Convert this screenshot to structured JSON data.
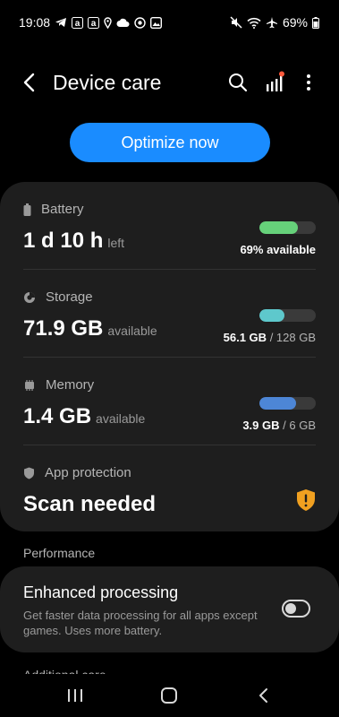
{
  "status_bar": {
    "time": "19:08",
    "battery_percent": "69%",
    "left_icons": [
      "telegram-icon",
      "amazon-icon",
      "amazon-icon",
      "location-icon",
      "cloud-icon",
      "instagram-icon",
      "gallery-icon"
    ],
    "right_icons": [
      "mute-icon",
      "wifi-icon",
      "airplane-icon",
      "battery-icon"
    ]
  },
  "header": {
    "title": "Device care",
    "icons": [
      "back-icon",
      "search-icon",
      "signal-stats-icon",
      "more-vert-icon"
    ]
  },
  "optimize_button": {
    "label": "Optimize now",
    "color": "#1a8cff"
  },
  "battery": {
    "label": "Battery",
    "value_main": "1 d 10 h",
    "value_suffix": "left",
    "detail": "69% available",
    "level": 0.69,
    "bar_color": "#66d17a"
  },
  "storage": {
    "label": "Storage",
    "value_main": "71.9 GB",
    "value_suffix": "available",
    "detail_used": "56.1 GB",
    "detail_total": "/ 128 GB",
    "level": 0.44,
    "bar_color": "#5ec8cc"
  },
  "memory": {
    "label": "Memory",
    "value_main": "1.4 GB",
    "value_suffix": "available",
    "detail_used": "3.9 GB",
    "detail_total": "/ 6 GB",
    "level": 0.65,
    "bar_color": "#4d86d6"
  },
  "app_protection": {
    "label": "App protection",
    "value_main": "Scan needed",
    "warning_color": "#f0a020"
  },
  "performance": {
    "section_title": "Performance",
    "enhanced_processing": {
      "title": "Enhanced processing",
      "description": "Get faster data processing for all apps except games. Uses more battery.",
      "enabled": false
    }
  },
  "additional_care": {
    "section_title": "Additional care"
  },
  "nav_bar": {
    "icons": [
      "recent-apps-icon",
      "home-icon",
      "back-nav-icon"
    ]
  }
}
